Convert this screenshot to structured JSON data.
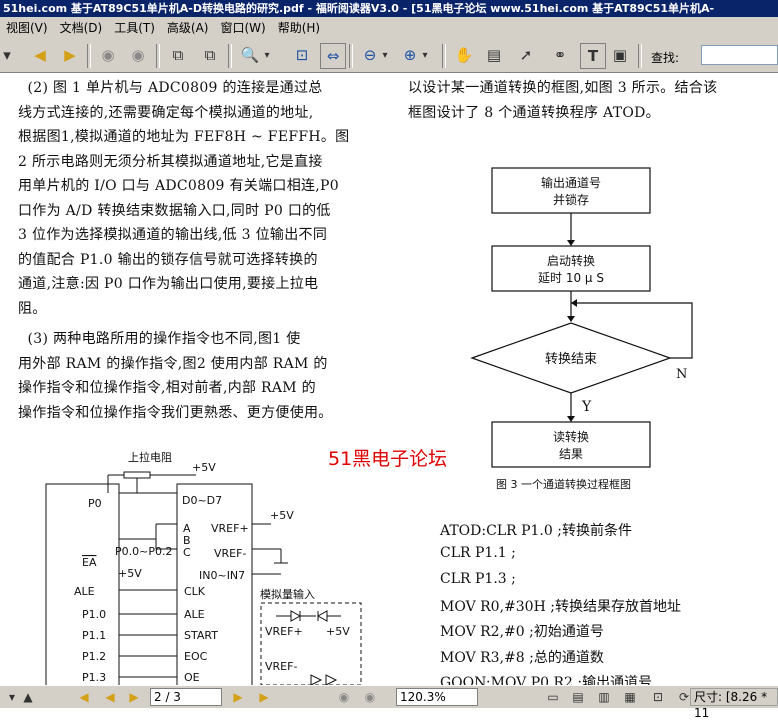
{
  "title": "51hei.com 基于AT89C51单片机A-D转换电路的研究.pdf - 福昕阅读器V3.0 - [51黑电子论坛 www.51hei.com 基于AT89C51单片机A-",
  "menu": [
    "视图(V)",
    "文档(D)",
    "工具(T)",
    "高级(A)",
    "窗口(W)",
    "帮助(H)"
  ],
  "toolbar": {
    "icons": [
      "back-icon",
      "prev-page-icon",
      "next-page-icon",
      "first-icon",
      "last-icon",
      "copy-page-icon",
      "paste-page-icon",
      "zoom-icon",
      "fit-page-icon",
      "fit-width-icon",
      "zoom-out-icon",
      "zoom-in-icon",
      "hand-icon",
      "snapshot-icon",
      "select-icon",
      "binoculars-icon",
      "text-select-icon",
      "image-select-icon"
    ],
    "search_label": "查找:",
    "search_value": ""
  },
  "page": {
    "left_paragraphs": [
      "  (2) 图 1 单片机与 ADC0809 的连接是通过总\n线方式连接的,还需要确定每个模拟通道的地址,\n根据图1,模拟通道的地址为 FEF8H ~ FEFFH。图\n2 所示电路则无须分析其模拟通道地址,它是直接\n用单片机的 I/O 口与 ADC0809 有关端口相连,P0\n口作为 A/D 转换结束数据输入口,同时 P0 口的低\n3 位作为选择模拟通道的输出线,低 3 位输出不同\n的值配合 P1.0 输出的锁存信号就可选择转换的\n通道,注意:因 P0 口作为输出口使用,要接上拉电\n阻。",
      "  (3) 两种电路所用的操作指令也不同,图1 使\n用外部 RAM 的操作指令,图2 使用内部 RAM 的\n操作指令和位操作指令,相对前者,内部 RAM 的\n操作指令和位操作指令我们更熟悉、更方便使用。"
    ],
    "right_intro": "以设计某一通道转换的框图,如图 3 所示。结合该\n框图设计了 8 个通道转换程序 ATOD。",
    "watermark": "51黑电子论坛",
    "flowchart": {
      "box1": [
        "输出通道号",
        "并锁存"
      ],
      "box2": [
        "启动转换",
        "延时 10 μ S"
      ],
      "decision": "转换结束",
      "no_label": "N",
      "yes_label": "Y",
      "box3": [
        "读转换",
        "结果"
      ],
      "caption": "图 3   一个通道转换过程框图"
    },
    "circuit": {
      "pullup": "上拉电阻",
      "vcc1": "+5V",
      "vcc2": "+5V",
      "vcc3": "+5V",
      "vcc4": "+5V",
      "p0": "P0",
      "d0d7": "D0~D7",
      "a": "A",
      "b": "B",
      "c": "C",
      "vref_plus": "VREF+",
      "vref_minus": "VREF-",
      "p00p02": "P0.0~P0.2",
      "ea": "EA",
      "in0in7": "IN0~IN7",
      "analog_in": "模拟量输入",
      "ale1": "ALE",
      "clk": "CLK",
      "p10": "P1.0",
      "ale2": "ALE",
      "p11": "P1.1",
      "start": "START",
      "p12": "P1.2",
      "eoc": "EOC",
      "p13": "P1.3",
      "oe": "OE",
      "vref_plus2": "VREF+",
      "vref_minus2": "VREF-"
    },
    "code_lines": [
      "ATOD:CLR P1.0 ;转换前条件",
      "CLR P1.1 ;",
      "CLR P1.3 ;",
      "MOV R0,#30H ;转换结果存放首地址",
      "MOV R2,#0 ;初始通道号",
      "MOV R3,#8 ;总的通道数",
      "GOON:MOV P0,R2 ;输出通道号"
    ]
  },
  "status": {
    "page_field": "2 / 3",
    "zoom_field": "120.3%",
    "size_label": "尺寸: [8.26 * 11"
  }
}
